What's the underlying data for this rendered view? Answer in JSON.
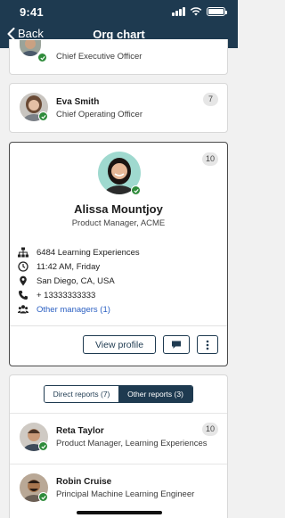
{
  "status_bar": {
    "time": "9:41"
  },
  "nav": {
    "back_label": "Back",
    "title": "Org chart"
  },
  "manager_top": {
    "role": "Chief Executive Officer"
  },
  "manager_coo": {
    "name": "Eva Smith",
    "role": "Chief Operating Officer",
    "count": "7"
  },
  "focused": {
    "name": "Alissa Mountjoy",
    "role": "Product Manager, ACME",
    "count": "10",
    "department": "6484 Learning Experiences",
    "local_time": "11:42 AM, Friday",
    "location": "San Diego, CA, USA",
    "phone": "+ 13333333333",
    "other_managers": "Other managers (1)",
    "view_profile_label": "View profile",
    "icons": {
      "department": "org-tree-icon",
      "time": "clock-icon",
      "location": "location-pin-icon",
      "phone": "phone-icon",
      "managers": "people-icon",
      "chat": "chat-icon",
      "more": "more-vertical-icon"
    }
  },
  "reports": {
    "tabs": {
      "direct": "Direct reports (7)",
      "other": "Other reports (3)",
      "selected": "other"
    },
    "items": [
      {
        "name": "Reta Taylor",
        "role": "Product Manager, Learning Experiences",
        "count": "10"
      },
      {
        "name": "Robin Cruise",
        "role": "Principal Machine Learning Engineer"
      }
    ]
  },
  "colors": {
    "header": "#1e3a50",
    "presence": "#2e8b3a",
    "link": "#2a5fc2"
  }
}
